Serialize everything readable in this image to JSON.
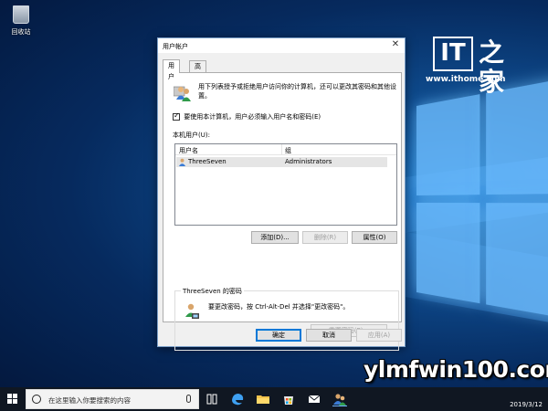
{
  "desktop": {
    "recycle_bin_label": "回收站",
    "ithome_brand": "IT",
    "ithome_zh": "之家",
    "ithome_url": "www.ithome.com",
    "watermark": "ylmfwin100.com"
  },
  "dialog": {
    "title": "用户帐户",
    "tabs": [
      "用户",
      "高级"
    ],
    "description": "用下列表授予或拒绝用户访问你的计算机，还可以更改其密码和其他设置。",
    "checkbox_label": "要使用本计算机，用户必须输入用户名和密码(E)",
    "checkbox_checked": true,
    "local_users_label": "本机用户(U):",
    "list_headers": [
      "用户名",
      "组"
    ],
    "list_rows": [
      {
        "user": "ThreeSeven",
        "group": "Administrators"
      }
    ],
    "add_button": "添加(D)...",
    "remove_button": "删除(R)",
    "properties_button": "属性(O)",
    "password_group_title": "ThreeSeven 的密码",
    "password_text": "要更改密码，按 Ctrl-Alt-Del 并选择\"更改密码\"。",
    "reset_password_button": "重置密码(P)...",
    "ok_button": "确定",
    "cancel_button": "取消",
    "apply_button": "应用(A)"
  },
  "taskbar": {
    "search_placeholder": "在这里输入你要搜索的内容",
    "date": "2019/3/12"
  },
  "colors": {
    "accent": "#0078d7",
    "selection": "#e5e5e5",
    "taskbar": "#101722"
  }
}
